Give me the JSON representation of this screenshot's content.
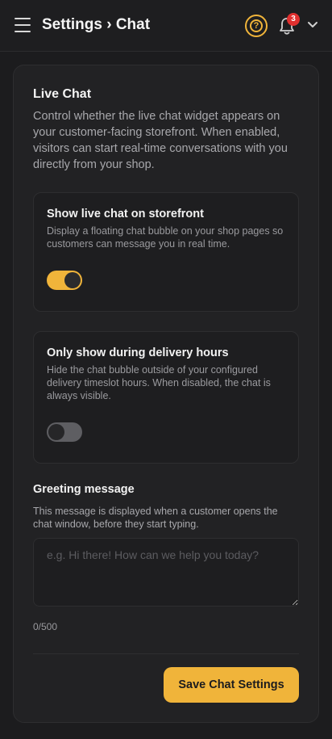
{
  "header": {
    "title": "Settings › Chat",
    "menu_icon": "hamburger-menu-icon",
    "help_icon": "help-circle-icon",
    "help_glyph": "?",
    "notification_icon": "bell-icon",
    "notification_count": "3",
    "account_chevron_icon": "chevron-down-icon"
  },
  "live_chat": {
    "title": "Live Chat",
    "description": "Control whether the live chat widget appears on your customer-facing storefront. When enabled, visitors can start real-time conversations with you directly from your shop.",
    "options": [
      {
        "title": "Show live chat on storefront",
        "description": "Display a floating chat bubble on your shop pages so customers can message you in real time.",
        "enabled": true
      },
      {
        "title": "Only show during delivery hours",
        "description": "Hide the chat bubble outside of your configured delivery timeslot hours. When disabled, the chat is always visible.",
        "enabled": false
      }
    ]
  },
  "greeting": {
    "label": "Greeting message",
    "description": "This message is displayed when a customer opens the chat window, before they start typing.",
    "value": "",
    "placeholder": "e.g. Hi there! How can we help you today?",
    "counter": "0/500"
  },
  "actions": {
    "save_label": "Save Chat Settings"
  },
  "colors": {
    "accent": "#f0b43a",
    "badge": "#e0302f",
    "background": "#1c1c1e",
    "card": "#222224"
  }
}
